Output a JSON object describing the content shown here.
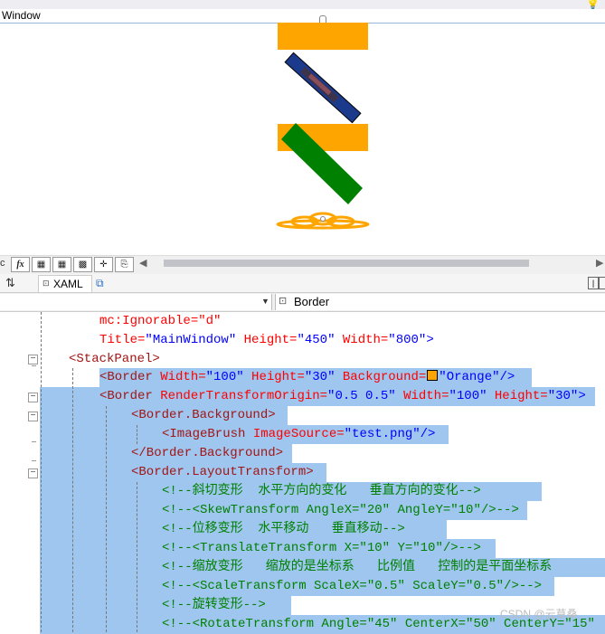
{
  "designer": {
    "window_title": "Window",
    "border_color": "#FFA500",
    "skew_color": "#008000"
  },
  "toolbar": {
    "buttons": [
      "fx",
      "grid",
      "grid2",
      "grid3",
      "snap",
      "copy"
    ]
  },
  "tabs": {
    "swap_label": "⇅",
    "xaml_label": "XAML"
  },
  "dropdown": {
    "left_value": "",
    "right_value": "Border"
  },
  "code": {
    "l1": "mc:Ignorable=\"d\"",
    "l2a": "Title=",
    "l2b": "\"MainWindow\"",
    "l2c": " Height=",
    "l2d": "\"450\"",
    "l2e": " Width=",
    "l2f": "\"800\"",
    "l2g": ">",
    "l3": "<StackPanel>",
    "l4a": "<Border",
    "l4b": " Width=",
    "l4c": "\"100\"",
    "l4d": " Height=",
    "l4e": "\"30\"",
    "l4f": " Background=",
    "l4g": "\"Orange\"",
    "l4h": "/>",
    "l5a": "<Border",
    "l5b": " RenderTransformOrigin=",
    "l5c": "\"0.5 0.5\"",
    "l5d": " Width=",
    "l5e": "\"100\"",
    "l5f": " Height=",
    "l5g": "\"30\"",
    "l5h": ">",
    "l6": "<Border.Background>",
    "l7a": "<ImageBrush",
    "l7b": " ImageSource=",
    "l7c": "\"test.png\"",
    "l7d": "/>",
    "l8": "</Border.Background>",
    "l9": "<Border.LayoutTransform>",
    "l10": "<!--斜切变形  水平方向的变化   垂直方向的变化-->",
    "l11": "<!--<SkewTransform AngleX=\"20\" AngleY=\"10\"/>-->",
    "l12": "<!--位移变形  水平移动   垂直移动-->",
    "l13": "<!--<TranslateTransform X=\"10\" Y=\"10\"/>-->",
    "l14": "<!--缩放变形   缩放的是坐标系   比例值   控制的是平面坐标系",
    "l15": "<!--<ScaleTransform ScaleX=\"0.5\" ScaleY=\"0.5\"/>-->",
    "l16": "<!--旋转变形-->",
    "l17": "<!--<RotateTransform Angle=\"45\" CenterX=\"50\" CenterY=\"15\""
  },
  "watermark": "CSDN @云草桑"
}
